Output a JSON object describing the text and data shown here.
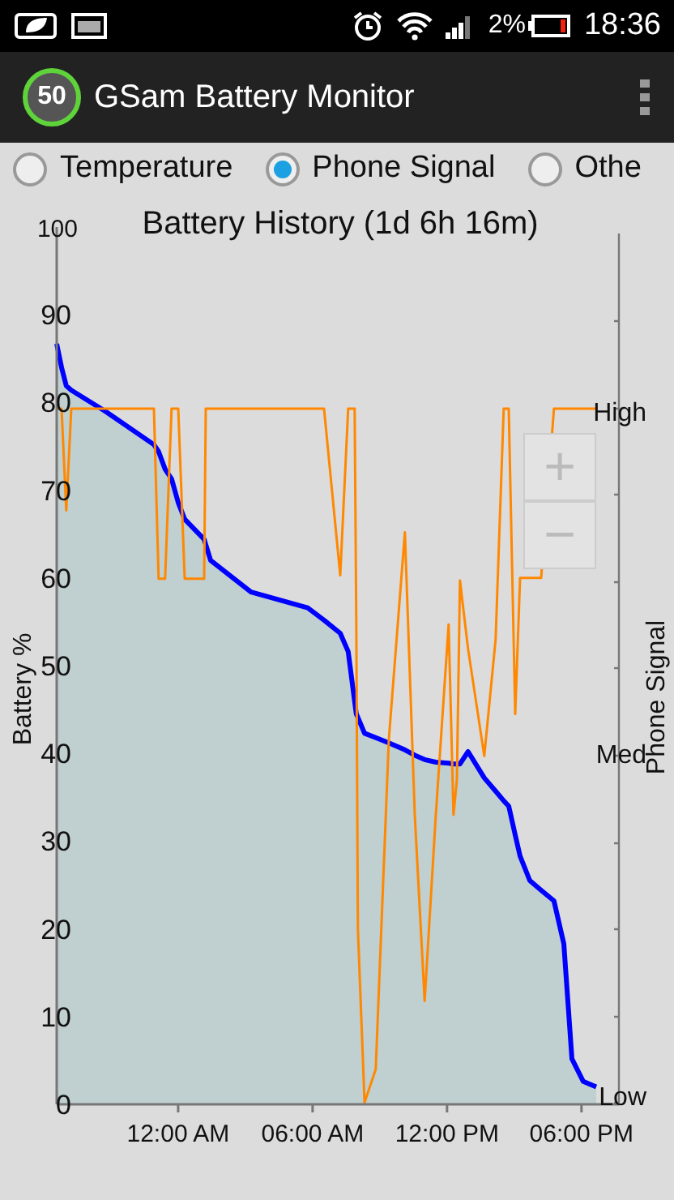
{
  "status_bar": {
    "battery_percent": "2%",
    "time": "18:36"
  },
  "app_bar": {
    "logo_text": "50",
    "title": "GSam Battery Monitor"
  },
  "graph_options": [
    {
      "label": "Temperature",
      "selected": false
    },
    {
      "label": "Phone Signal",
      "selected": true
    },
    {
      "label": "Othe",
      "selected": false
    }
  ],
  "chart": {
    "zoom_in": "+",
    "zoom_out": "−",
    "signal_axis": {
      "ticks": [
        "High",
        "Med",
        "Low"
      ]
    },
    "chart_data": {
      "type": "area",
      "title": "Battery History (1d 6h 16m)",
      "ylabel": "Battery %",
      "x": [
        -5.42,
        -5.2,
        -4.99,
        -4.77,
        -3.25,
        -1.08,
        -0.87,
        -0.58,
        -0.29,
        0,
        0.29,
        1.16,
        1.23,
        1.45,
        3.25,
        5.78,
        6.51,
        7.23,
        7.59,
        7.88,
        7.95,
        8.02,
        8.32,
        8.82,
        9.4,
        10.12,
        10.56,
        11,
        11.5,
        12.07,
        12.29,
        12.44,
        12.58,
        12.94,
        13.66,
        14.17,
        14.53,
        14.75,
        15.04,
        15.26,
        15.69,
        16.2,
        16.77,
        17.21,
        17.57,
        18.08,
        18.66
      ],
      "series": [
        {
          "type": "area",
          "color": "#0000ff",
          "values": [
            86.7,
            84,
            81.9,
            81.4,
            79,
            75.2,
            74.4,
            72.4,
            71.3,
            68.6,
            66.7,
            64.4,
            63.8,
            62,
            58.4,
            56.6,
            55.2,
            53.7,
            51.6,
            45.9,
            44.5,
            44.1,
            42.3,
            41.8,
            41.2,
            40.4,
            39.8,
            39.3,
            39,
            38.9,
            38.8,
            38.8,
            38.8,
            40.2,
            37.2,
            35.7,
            34.6,
            34,
            30.7,
            28.3,
            25.5,
            24.4,
            23.2,
            18.3,
            5.2,
            2.6,
            2
          ]
        },
        {
          "type": "line",
          "name": "Phone Signal",
          "color": "#ff8800",
          "values": [
            79.3,
            79.3,
            67.7,
            79.3,
            79.3,
            79.3,
            59.9,
            59.9,
            79.3,
            79.3,
            59.9,
            59.9,
            79.3,
            79.3,
            79.3,
            79.3,
            79.3,
            60.3,
            79.3,
            79.3,
            55,
            20,
            0.2,
            4,
            41.6,
            65.2,
            33,
            11.8,
            33,
            54.7,
            33,
            37,
            59.7,
            51.9,
            39.7,
            53,
            79.3,
            79.3,
            44.5,
            60,
            60,
            60,
            79.3,
            79.3,
            79.3,
            79.3,
            79.3
          ]
        }
      ],
      "xlim": [
        -5.42,
        19.67
      ],
      "ylim": [
        0,
        100
      ],
      "xticks": [
        {
          "value": 0,
          "label": "12:00 AM"
        },
        {
          "value": 6,
          "label": "06:00 AM"
        },
        {
          "value": 12,
          "label": "12:00 PM"
        },
        {
          "value": 18,
          "label": "06:00 PM"
        }
      ],
      "yticks": [
        0,
        10,
        20,
        30,
        40,
        50,
        60,
        70,
        80,
        90,
        100
      ]
    }
  }
}
